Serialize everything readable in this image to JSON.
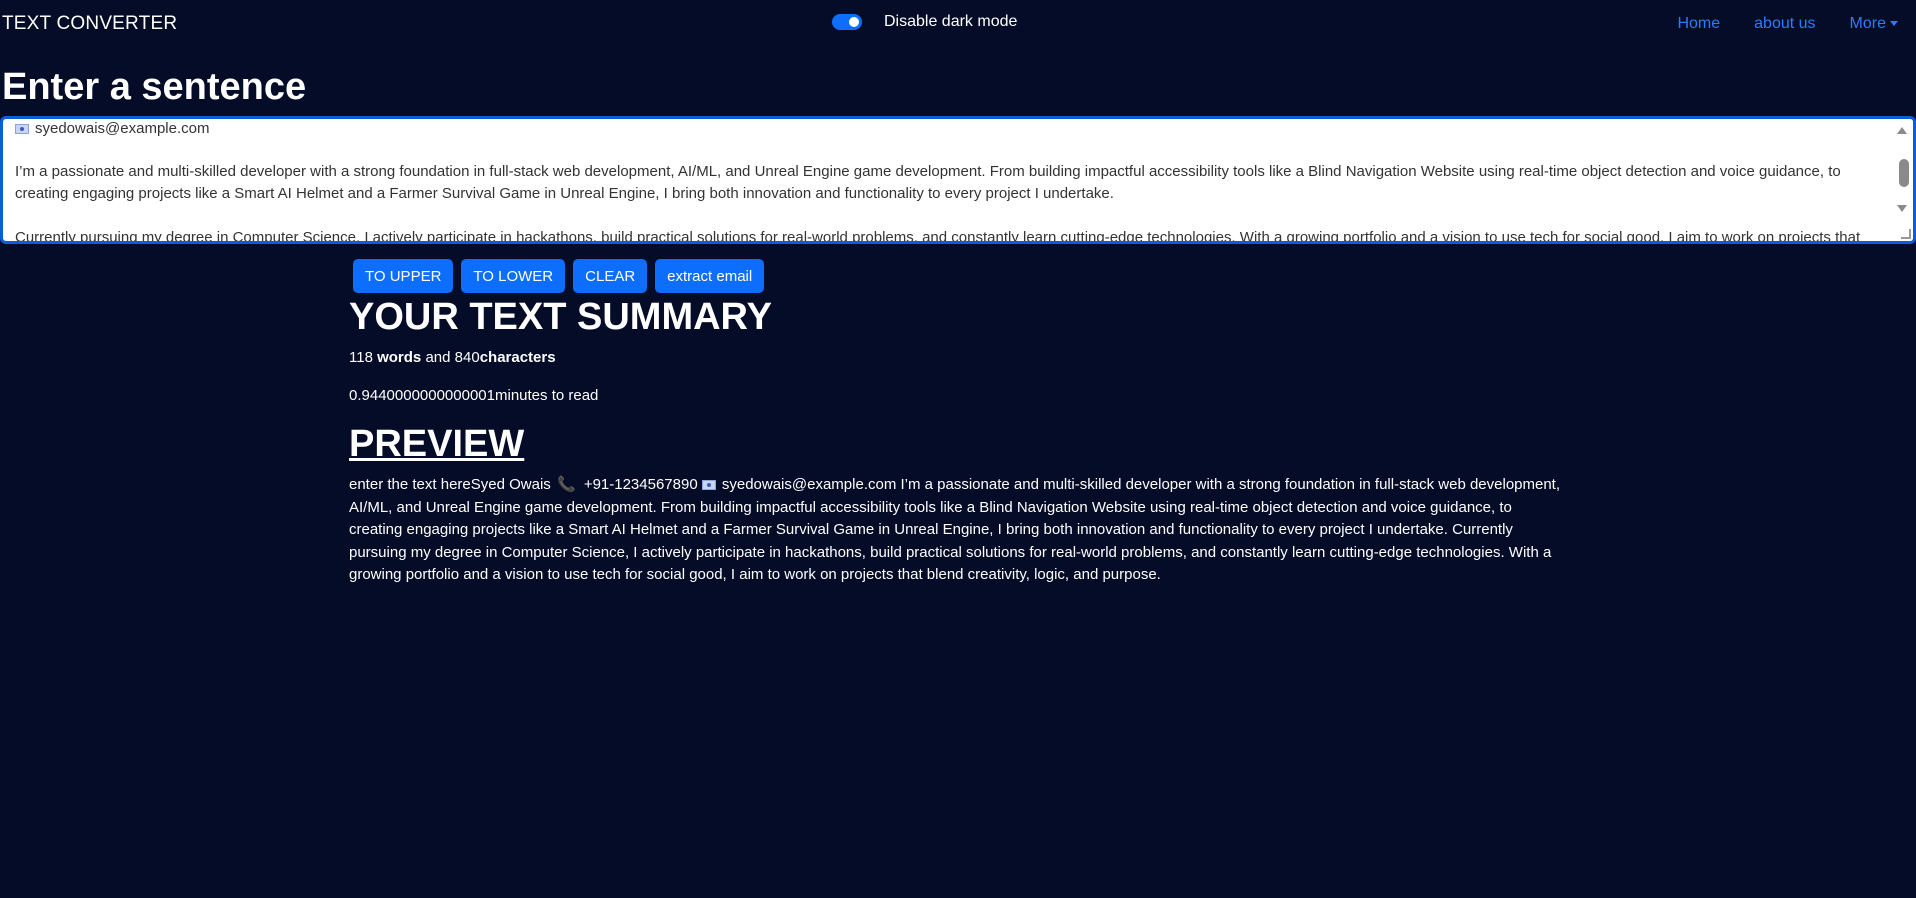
{
  "navbar": {
    "brand": "TEXT CONVERTER",
    "toggle_label": "Disable dark mode",
    "links": [
      "Home",
      "about us",
      "More"
    ]
  },
  "form": {
    "heading": "Enter a sentence",
    "textarea_lines": [
      "syedowais@example.com",
      "I’m a passionate and multi-skilled developer with a strong foundation in full-stack web development, AI/ML, and Unreal Engine game development. From building impactful accessibility tools like a Blind Navigation Website using real-time object detection and voice guidance, to creating engaging projects like a Smart AI Helmet and a Farmer Survival Game in Unreal Engine, I bring both innovation and functionality to every project I undertake.",
      "Currently pursuing my degree in Computer Science, I actively participate in hackathons, build practical solutions for real-world problems, and constantly learn cutting-edge technologies. With a growing portfolio and a vision to use tech for social good, I aim to work on projects that"
    ]
  },
  "buttons": {
    "upper": "TO UPPER",
    "lower": "TO LOWER",
    "clear": "CLEAR",
    "extract": "extract email"
  },
  "summary": {
    "title": "YOUR TEXT SUMMARY",
    "word_count": "118",
    "words_label": "words",
    "and_text": "and",
    "char_count": "840",
    "chars_label": "characters",
    "read_time": "0.9440000000000001",
    "read_label": "minutes to read"
  },
  "preview": {
    "title": "PREVIEW",
    "part1": "enter the text hereSyed Owais",
    "part2": "+91-1234567890",
    "part3": "syedowais@example.com I’m a passionate and multi-skilled developer with a strong foundation in full-stack web development, AI/ML, and Unreal Engine game development. From building impactful accessibility tools like a Blind Navigation Website using real-time object detection and voice guidance, to creating engaging projects like a Smart AI Helmet and a Farmer Survival Game in Unreal Engine, I bring both innovation and functionality to every project I undertake. Currently pursuing my degree in Computer Science, I actively participate in hackathons, build practical solutions for real-world problems, and constantly learn cutting-edge technologies. With a growing portfolio and a vision to use tech for social good, I aim to work on projects that blend creativity, logic, and purpose."
  },
  "colors": {
    "background": "#050c27",
    "accent": "#0d6efd",
    "link": "#2b7bff"
  }
}
